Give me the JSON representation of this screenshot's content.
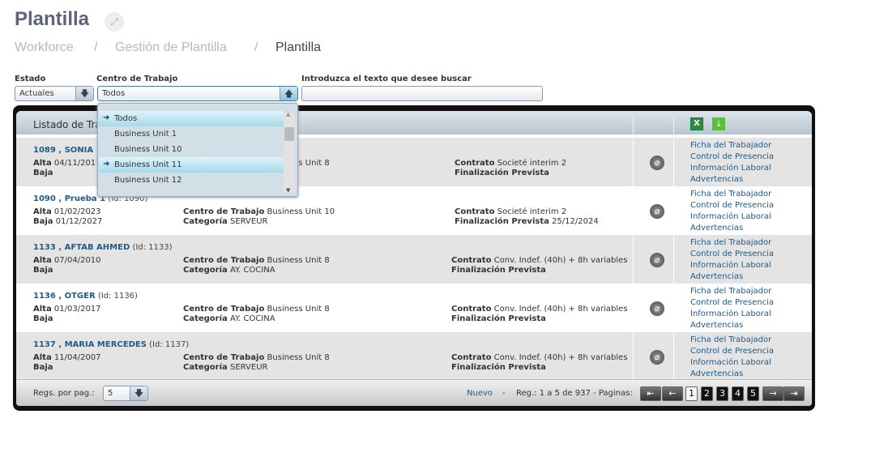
{
  "page": {
    "title": "Plantilla",
    "breadcrumb": [
      "Workforce",
      "/",
      "Gestión de Plantilla",
      "/",
      "Plantilla"
    ]
  },
  "filters": {
    "estado_label": "Estado",
    "estado_value": "Actuales",
    "centro_label": "Centro de Trabajo",
    "centro_value": "Todos",
    "search_label": "Introduzca el texto que desee buscar",
    "search_value": ""
  },
  "dropdown": {
    "options": [
      "Todos",
      "Business Unit 1",
      "Business Unit 10",
      "Business Unit 11",
      "Business Unit 12"
    ],
    "highlighted": [
      "Todos",
      "Business Unit 11"
    ]
  },
  "list": {
    "title": "Listado de Trabajadores",
    "labels": {
      "alta": "Alta",
      "baja": "Baja",
      "centro": "Centro de Trabajo",
      "categoria": "Categoría",
      "contrato": "Contrato",
      "fin": "Finalización Prevista"
    },
    "links": [
      "Ficha del Trabajador",
      "Control de Presencia",
      "Información Laboral",
      "Advertencias"
    ],
    "rows": [
      {
        "name": "1089 , SONIA",
        "id": "",
        "alta": "04/11/201",
        "baja": "",
        "centro": "Business Unit 8",
        "categoria": "",
        "contrato": "Societé interim 2",
        "fin": ""
      },
      {
        "name": "1090 , Prueba 1",
        "id": "(Id: 1090)",
        "alta": "01/02/2023",
        "baja": "01/12/2027",
        "centro": "Business Unit 10",
        "categoria": "SERVEUR",
        "contrato": "Societé interim 2",
        "fin": "25/12/2024"
      },
      {
        "name": "1133 , AFTAB AHMED",
        "id": "(Id: 1133)",
        "alta": "07/04/2010",
        "baja": "",
        "centro": "Business Unit 8",
        "categoria": "AY. COCINA",
        "contrato": "Conv. Indef. (40h) + 8h variables",
        "fin": ""
      },
      {
        "name": "1136 , OTGER",
        "id": "(Id: 1136)",
        "alta": "01/03/2017",
        "baja": "",
        "centro": "Business Unit 8",
        "categoria": "AY. COCINA",
        "contrato": "Conv. Indef. (40h) + 8h variables",
        "fin": ""
      },
      {
        "name": "1137 , MARIA MERCEDES",
        "id": "(Id: 1137)",
        "alta": "11/04/2007",
        "baja": "",
        "centro": "Business Unit 8",
        "categoria": "SERVEUR",
        "contrato": "Conv. Indef. (40h) + 8h variables",
        "fin": ""
      }
    ]
  },
  "footer": {
    "regs_label": "Regs. por pag.:",
    "regs_value": "5",
    "nuevo": "Nuevo",
    "dash": "-",
    "summary": "Reg.: 1 a 5 de 937 - Paginas:",
    "pages": [
      "1",
      "2",
      "3",
      "4",
      "5"
    ],
    "current_page": "1"
  }
}
